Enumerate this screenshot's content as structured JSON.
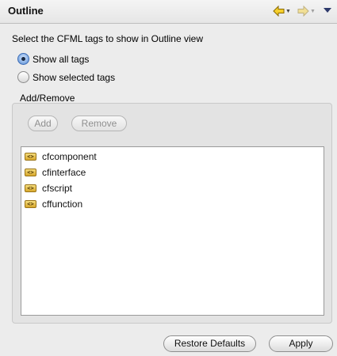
{
  "header": {
    "title": "Outline",
    "nav": {
      "back_icon": "arrow-left-icon",
      "forward_icon": "arrow-right-icon",
      "menu_icon": "view-menu-icon",
      "back_color": "#f0c000"
    }
  },
  "description": "Select the CFML tags to show in Outline view",
  "options": [
    {
      "label": "Show all tags",
      "checked": true
    },
    {
      "label": "Show selected tags",
      "checked": false
    }
  ],
  "group": {
    "label": "Add/Remove",
    "add_label": "Add",
    "remove_label": "Remove",
    "items": [
      {
        "label": "cfcomponent",
        "icon": "tag-icon"
      },
      {
        "label": "cfinterface",
        "icon": "tag-icon"
      },
      {
        "label": "cfscript",
        "icon": "tag-icon"
      },
      {
        "label": "cffunction",
        "icon": "tag-icon"
      }
    ]
  },
  "footer": {
    "restore_label": "Restore Defaults",
    "apply_label": "Apply"
  }
}
